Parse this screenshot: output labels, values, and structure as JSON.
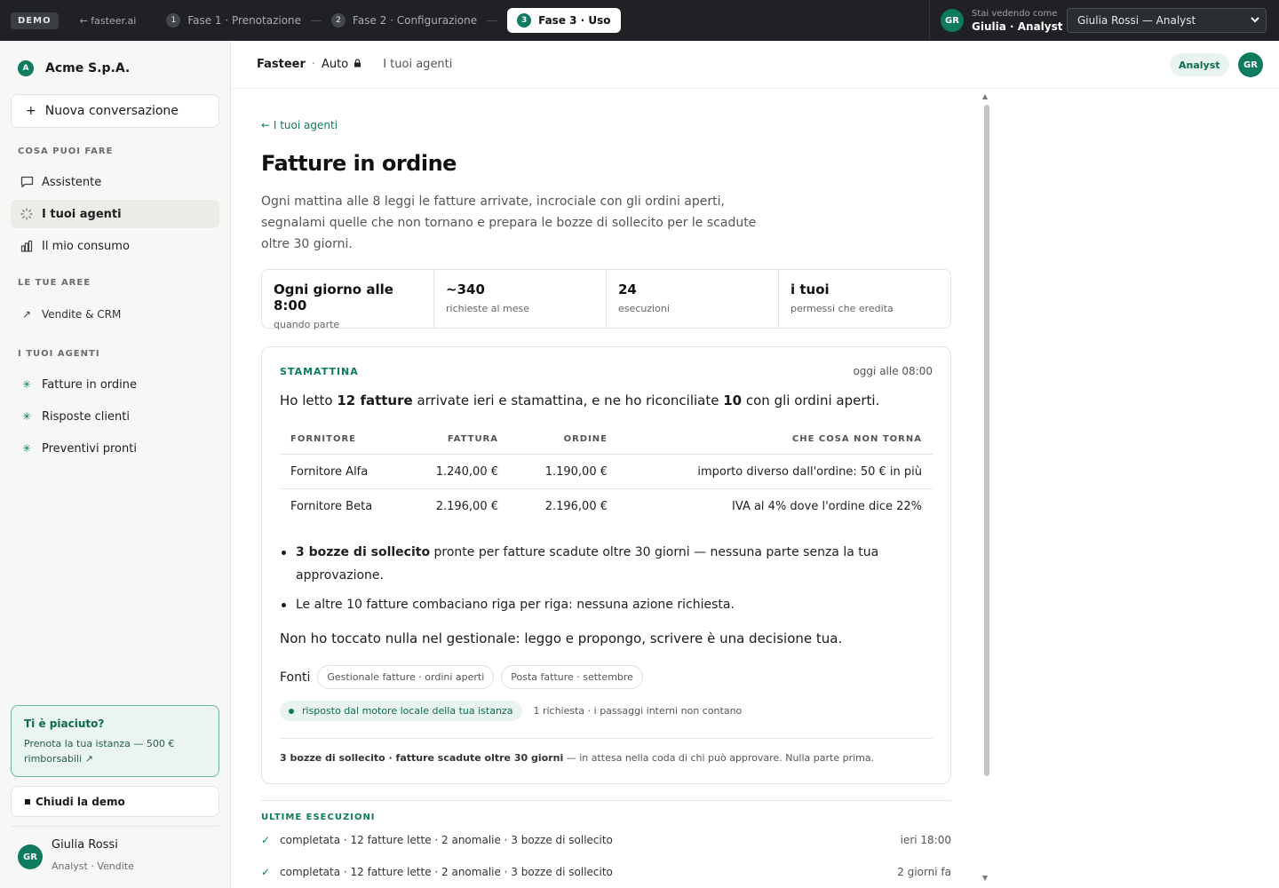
{
  "topbar": {
    "demo_badge": "DEMO",
    "back_link": "← fasteer.ai",
    "steps": [
      {
        "num": "1",
        "label": "Fase 1 · Prenotazione"
      },
      {
        "num": "2",
        "label": "Fase 2 · Configurazione"
      },
      {
        "num": "3",
        "label": "Fase 3 · Uso"
      }
    ],
    "separator": "—",
    "viewing_small": "Stai vedendo come",
    "viewing_user": "Giulia · Analyst",
    "avatar": "GR",
    "user_select_value": "Giulia Rossi — Analyst"
  },
  "sidebar": {
    "org_initial": "A",
    "org_name": "Acme S.p.A.",
    "new_conversation": "Nuova conversazione",
    "section_can_do": "COSA PUOI FARE",
    "nav": [
      {
        "label": "Assistente",
        "icon": "chat-icon"
      },
      {
        "label": "I tuoi agenti",
        "icon": "agents-icon"
      },
      {
        "label": "Il mio consumo",
        "icon": "chart-icon"
      }
    ],
    "section_areas": "LE TUE AREE",
    "areas": [
      {
        "label": "Vendite & CRM",
        "icon": "trend-arrow-icon"
      }
    ],
    "section_agents": "I TUOI AGENTI",
    "agents": [
      {
        "label": "Fatture in ordine"
      },
      {
        "label": "Risposte clienti"
      },
      {
        "label": "Preventivi pronti"
      }
    ],
    "promo_title": "Ti è piaciuto?",
    "promo_desc": "Prenota la tua istanza — 500 € rimborsabili ↗",
    "close_demo": "Chiudi la demo",
    "user_avatar": "GR",
    "user_name": "Giulia Rossi",
    "user_role": "Analyst · Vendite"
  },
  "header": {
    "brand": "Fasteer",
    "mode": "Auto",
    "page": "I tuoi agenti",
    "role_pill": "Analyst",
    "avatar": "GR"
  },
  "agent": {
    "back": "← I tuoi agenti",
    "title": "Fatture in ordine",
    "description": "Ogni mattina alle 8 leggi le fatture arrivate, incrociale con gli ordini aperti, segnalami quelle che non tornano e prepara le bozze di sollecito per le scadute oltre 30 giorni.",
    "stats": [
      {
        "value": "Ogni giorno alle 8:00",
        "label": "quando parte"
      },
      {
        "value": "~340",
        "label": "richieste al mese"
      },
      {
        "value": "24",
        "label": "esecuzioni"
      },
      {
        "value": "i tuoi",
        "label": "permessi che eredita"
      }
    ]
  },
  "report": {
    "label": "STAMATTINA",
    "time": "oggi alle 08:00",
    "lead_1": "Ho letto ",
    "lead_b1": "12 fatture",
    "lead_2": " arrivate ieri e stamattina, e ne ho riconciliate ",
    "lead_b2": "10",
    "lead_3": " con gli ordini aperti.",
    "columns": [
      "FORNITORE",
      "FATTURA",
      "ORDINE",
      "CHE COSA NON TORNA"
    ],
    "rows": [
      {
        "supplier": "Fornitore Alfa",
        "invoice": "1.240,00 €",
        "order": "1.190,00 €",
        "issue": "importo diverso dall'ordine: 50 € in più"
      },
      {
        "supplier": "Fornitore Beta",
        "invoice": "2.196,00 €",
        "order": "2.196,00 €",
        "issue": "IVA al 4% dove l'ordine dice 22%"
      }
    ],
    "bullet1_bold": "3 bozze di sollecito",
    "bullet1_rest": " pronte per fatture scadute oltre 30 giorni — nessuna parte senza la tua approvazione.",
    "bullet2": "Le altre 10 fatture combaciano riga per riga: nessuna azione richiesta.",
    "closing": "Non ho toccato nulla nel gestionale: leggo e propongo, scrivere è una decisione tua.",
    "sources_label": "Fonti",
    "sources": [
      "Gestionale fatture · ordini aperti",
      "Posta fatture · settembre"
    ],
    "engine": "risposto dal motore locale della tua istanza",
    "engine_note": "1 richiesta · i passaggi interni non contano",
    "foot_bold": "3 bozze di sollecito · fatture scadute oltre 30 giorni",
    "foot_rest": " — in attesa nella coda di chi può approvare. Nulla parte prima."
  },
  "runs": {
    "title": "ULTIME ESECUZIONI",
    "items": [
      {
        "check": "✓",
        "text": "completata · 12 fatture lette · 2 anomalie · 3 bozze di sollecito",
        "date": "ieri 18:00"
      },
      {
        "check": "✓",
        "text": "completata · 12 fatture lette · 2 anomalie · 3 bozze di sollecito",
        "date": "2 giorni fa"
      }
    ]
  }
}
